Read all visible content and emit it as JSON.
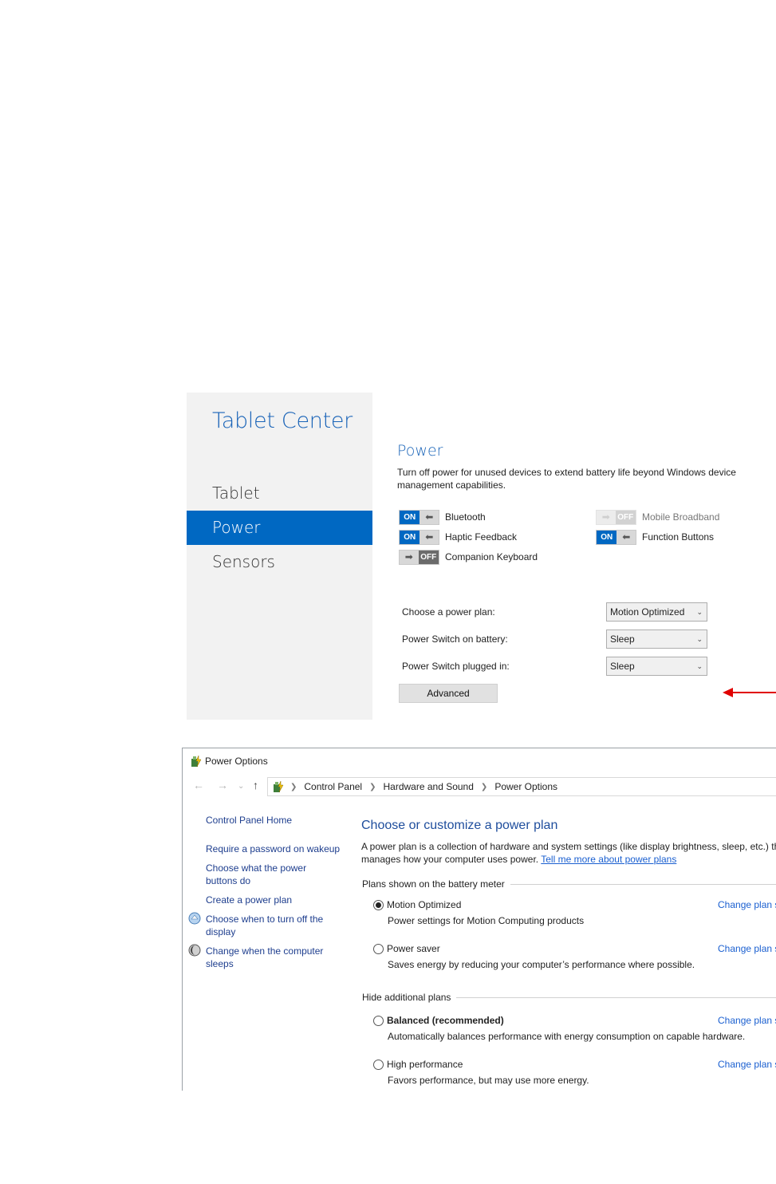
{
  "tablet_center": {
    "title": "Tablet Center",
    "nav": [
      "Tablet",
      "Power",
      "Sensors"
    ],
    "active_nav": "Power",
    "accent_color": "#0068c2",
    "power": {
      "heading": "Power",
      "description": "Turn off power for unused devices to extend battery life beyond Windows device management capabilities.",
      "toggles": [
        {
          "state": "ON",
          "label": "Bluetooth",
          "enabled": true
        },
        {
          "state": "ON",
          "label": "Haptic Feedback",
          "enabled": true
        },
        {
          "state": "OFF",
          "label": "Companion Keyboard",
          "enabled": true
        },
        {
          "state": "OFF",
          "label": "Mobile Broadband",
          "enabled": false
        },
        {
          "state": "ON",
          "label": "Function Buttons",
          "enabled": true
        }
      ],
      "settings": [
        {
          "label": "Choose a power plan:",
          "value": "Motion Optimized"
        },
        {
          "label": "Power Switch on battery:",
          "value": "Sleep"
        },
        {
          "label": "Power Switch plugged in:",
          "value": "Sleep"
        }
      ],
      "advanced_button": "Advanced",
      "annotation_arrow_color": "#e00000"
    }
  },
  "power_options": {
    "window_title": "Power Options",
    "breadcrumb": [
      "Control Panel",
      "Hardware and Sound",
      "Power Options"
    ],
    "sidebar": {
      "home": "Control Panel Home",
      "links": [
        "Require a password on wakeup",
        "Choose what the power buttons do",
        "Create a power plan",
        "Choose when to turn off the display",
        "Change when the computer sleeps"
      ]
    },
    "heading": "Choose or customize a power plan",
    "description": "A power plan is a collection of hardware and system settings (like display brightness, sleep, etc.) that manages how your computer uses power.",
    "learn_more_link": "Tell me more about power plans",
    "battery_meter_group": "Plans shown on the battery meter",
    "hidden_group": "Hide additional plans",
    "change_plan_label": "Change plan settings",
    "plans": [
      {
        "name": "Motion Optimized",
        "desc": "Power settings for Motion Computing products",
        "selected": true
      },
      {
        "name": "Power saver",
        "desc": "Saves energy by reducing your computer’s performance where possible.",
        "selected": false
      },
      {
        "name": "Balanced (recommended)",
        "desc": "Automatically balances performance with energy consumption on capable hardware.",
        "selected": false
      },
      {
        "name": "High performance",
        "desc": "Favors performance, but may use more energy.",
        "selected": false
      }
    ]
  }
}
